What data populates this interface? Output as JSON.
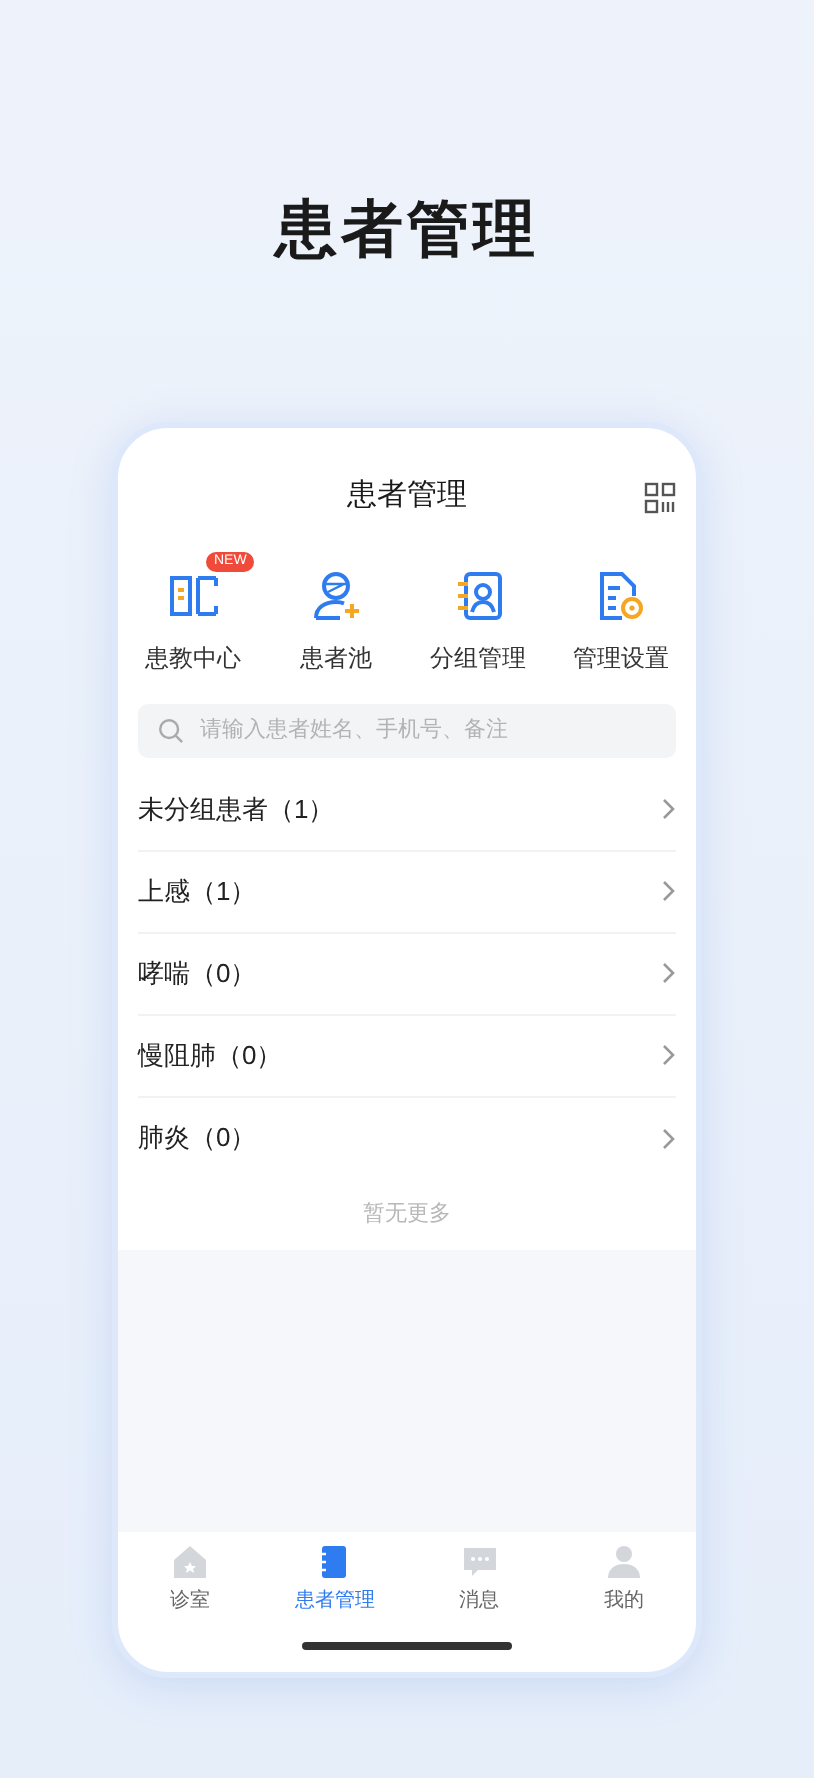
{
  "headline": "患者管理",
  "app": {
    "title": "患者管理",
    "features": [
      {
        "kind": "education",
        "label": "患教中心",
        "badge": "NEW"
      },
      {
        "kind": "pool",
        "label": "患者池"
      },
      {
        "kind": "group",
        "label": "分组管理"
      },
      {
        "kind": "settings",
        "label": "管理设置"
      }
    ],
    "search": {
      "placeholder": "请输入患者姓名、手机号、备注"
    },
    "groups": [
      {
        "name": "未分组患者",
        "count": "（1）"
      },
      {
        "name": "上感",
        "count": "（1）"
      },
      {
        "name": "哮喘",
        "count": "（0）"
      },
      {
        "name": "慢阻肺",
        "count": "（0）"
      },
      {
        "name": "肺炎",
        "count": "（0）"
      }
    ],
    "footer_note": "暂无更多",
    "tabs": [
      {
        "kind": "home",
        "label": "诊室",
        "selected": false
      },
      {
        "kind": "notebook",
        "label": "患者管理",
        "selected": true
      },
      {
        "kind": "chat",
        "label": "消息",
        "selected": false
      },
      {
        "kind": "person",
        "label": "我的",
        "selected": false
      }
    ]
  }
}
